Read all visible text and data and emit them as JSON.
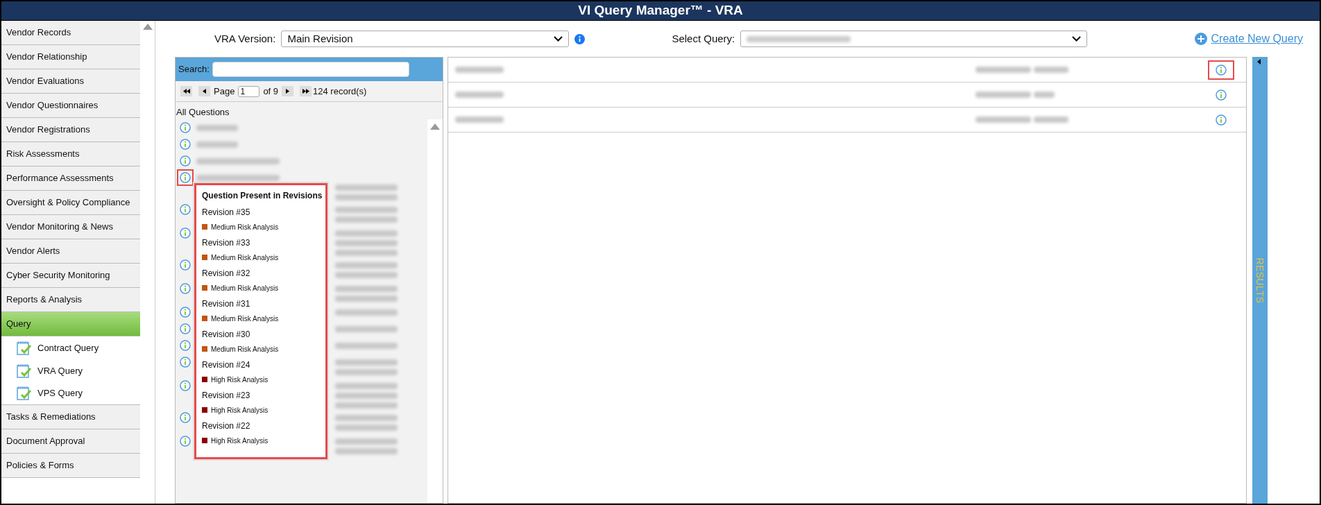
{
  "window": {
    "title": "VI Query Manager™ - VRA"
  },
  "sidebar": {
    "items": [
      {
        "label": "Vendor Records",
        "selected": false
      },
      {
        "label": "Vendor Relationship",
        "selected": false
      },
      {
        "label": "Vendor Evaluations",
        "selected": false
      },
      {
        "label": "Vendor Questionnaires",
        "selected": false
      },
      {
        "label": "Vendor Registrations",
        "selected": false
      },
      {
        "label": "Risk Assessments",
        "selected": false
      },
      {
        "label": "Performance Assessments",
        "selected": false
      },
      {
        "label": "Oversight & Policy Compliance",
        "selected": false
      },
      {
        "label": "Vendor Monitoring & News",
        "selected": false
      },
      {
        "label": "Vendor Alerts",
        "selected": false
      },
      {
        "label": "Cyber Security Monitoring",
        "selected": false
      },
      {
        "label": "Reports & Analysis",
        "selected": false
      },
      {
        "label": "Query",
        "selected": true,
        "expanded": true,
        "children": [
          {
            "label": "Contract Query"
          },
          {
            "label": "VRA Query"
          },
          {
            "label": "VPS Query"
          }
        ]
      },
      {
        "label": "Tasks & Remediations",
        "selected": false
      },
      {
        "label": "Document Approval",
        "selected": false
      },
      {
        "label": "Policies & Forms",
        "selected": false
      }
    ]
  },
  "toolbar": {
    "version_label": "VRA Version:",
    "version_value": "Main Revision",
    "query_label": "Select Query:",
    "create_link": "Create New Query"
  },
  "questions_panel": {
    "search_label": "Search:",
    "pager": {
      "page_label": "Page",
      "page_value": "1",
      "of_label": "of 9",
      "records": "124 record(s)"
    },
    "heading": "All Questions",
    "items": [
      {
        "kind": "one",
        "highlighted": false
      },
      {
        "kind": "one",
        "highlighted": false
      },
      {
        "kind": "one",
        "highlighted": false
      },
      {
        "kind": "three",
        "highlighted": true
      },
      {
        "kind": "two",
        "highlighted": false
      },
      {
        "kind": "three",
        "highlighted": false
      },
      {
        "kind": "two",
        "highlighted": false
      },
      {
        "kind": "two",
        "highlighted": false
      },
      {
        "kind": "one",
        "highlighted": false
      },
      {
        "kind": "one",
        "highlighted": false
      },
      {
        "kind": "one",
        "highlighted": false
      },
      {
        "kind": "two",
        "highlighted": false
      },
      {
        "kind": "three",
        "highlighted": false
      },
      {
        "kind": "two",
        "highlighted": false
      },
      {
        "kind": "two",
        "highlighted": false
      }
    ]
  },
  "popup": {
    "title": "Question Present in Revisions",
    "revisions": [
      {
        "revision": "Revision #35",
        "risk": "Medium Risk Analysis",
        "color": "#c0560e"
      },
      {
        "revision": "Revision #33",
        "risk": "Medium Risk Analysis",
        "color": "#c0560e"
      },
      {
        "revision": "Revision #32",
        "risk": "Medium Risk Analysis",
        "color": "#c0560e"
      },
      {
        "revision": "Revision #31",
        "risk": "Medium Risk Analysis",
        "color": "#c0560e"
      },
      {
        "revision": "Revision #30",
        "risk": "Medium Risk Analysis",
        "color": "#c0560e"
      },
      {
        "revision": "Revision #24",
        "risk": "High Risk Analysis",
        "color": "#8b0000"
      },
      {
        "revision": "Revision #23",
        "risk": "High Risk Analysis",
        "color": "#8b0000"
      },
      {
        "revision": "Revision #22",
        "risk": "High Risk Analysis",
        "color": "#8b0000"
      }
    ]
  },
  "results": {
    "rows": [
      {
        "highlighted": true
      },
      {
        "highlighted": false
      },
      {
        "highlighted": false
      }
    ],
    "side_tab": "RESULTS"
  }
}
